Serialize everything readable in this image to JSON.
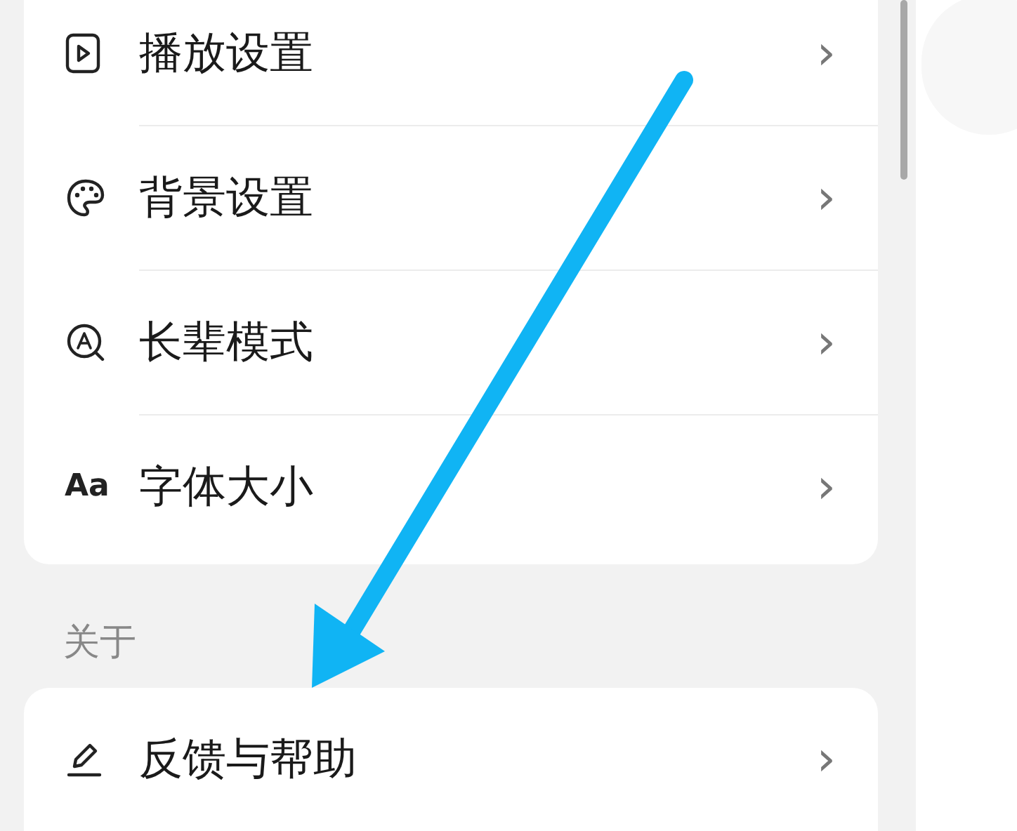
{
  "settings_group": {
    "rows": [
      {
        "label": "播放设置",
        "chevron": "›"
      },
      {
        "label": "背景设置",
        "chevron": "›"
      },
      {
        "label": "长辈模式",
        "chevron": "›"
      },
      {
        "label": "字体大小",
        "icon_text": "Aa",
        "chevron": "›"
      }
    ]
  },
  "about_section": {
    "heading": "关于",
    "rows": [
      {
        "label": "反馈与帮助",
        "chevron": "›"
      }
    ]
  }
}
